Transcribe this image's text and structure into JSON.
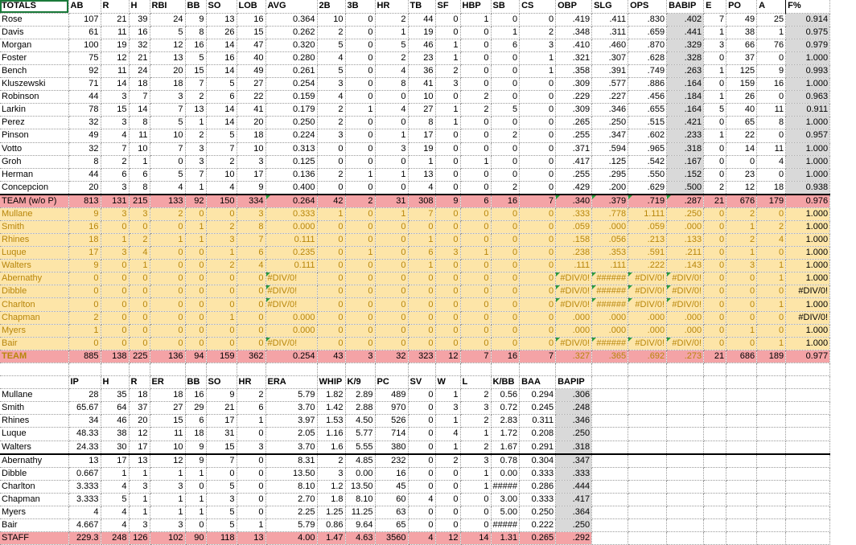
{
  "batting_header": [
    "TOTALS",
    "AB",
    "R",
    "H",
    "RBI",
    "BB",
    "SO",
    "LOB",
    "AVG",
    "2B",
    "3B",
    "HR",
    "TB",
    "SF",
    "HBP",
    "SB",
    "CS",
    "OBP",
    "SLG",
    "OPS",
    "BABIP",
    "E",
    "PO",
    "A",
    "F%"
  ],
  "batting_rows": [
    [
      "Rose",
      "107",
      "21",
      "39",
      "24",
      "9",
      "13",
      "16",
      "0.364",
      "10",
      "0",
      "2",
      "44",
      "0",
      "1",
      "0",
      "0",
      ".419",
      ".411",
      ".830",
      ".402",
      "7",
      "49",
      "25",
      "0.914"
    ],
    [
      "Davis",
      "61",
      "11",
      "16",
      "5",
      "8",
      "26",
      "15",
      "0.262",
      "2",
      "0",
      "1",
      "19",
      "0",
      "0",
      "1",
      "2",
      ".348",
      ".311",
      ".659",
      ".441",
      "1",
      "38",
      "1",
      "0.975"
    ],
    [
      "Morgan",
      "100",
      "19",
      "32",
      "12",
      "16",
      "14",
      "47",
      "0.320",
      "5",
      "0",
      "5",
      "46",
      "1",
      "0",
      "6",
      "3",
      ".410",
      ".460",
      ".870",
      ".329",
      "3",
      "66",
      "76",
      "0.979"
    ],
    [
      "Foster",
      "75",
      "12",
      "21",
      "13",
      "5",
      "16",
      "40",
      "0.280",
      "4",
      "0",
      "2",
      "23",
      "1",
      "0",
      "0",
      "1",
      ".321",
      ".307",
      ".628",
      ".328",
      "0",
      "37",
      "0",
      "1.000"
    ],
    [
      "Bench",
      "92",
      "11",
      "24",
      "20",
      "15",
      "14",
      "49",
      "0.261",
      "5",
      "0",
      "4",
      "36",
      "2",
      "0",
      "0",
      "1",
      ".358",
      ".391",
      ".749",
      ".263",
      "1",
      "125",
      "9",
      "0.993"
    ],
    [
      "Kluszewski",
      "71",
      "14",
      "18",
      "18",
      "7",
      "5",
      "27",
      "0.254",
      "3",
      "0",
      "8",
      "41",
      "3",
      "0",
      "0",
      "0",
      ".309",
      ".577",
      ".886",
      ".164",
      "0",
      "159",
      "16",
      "1.000"
    ],
    [
      "Robinson",
      "44",
      "3",
      "7",
      "3",
      "2",
      "6",
      "22",
      "0.159",
      "4",
      "0",
      "0",
      "10",
      "0",
      "2",
      "0",
      "0",
      ".229",
      ".227",
      ".456",
      ".184",
      "1",
      "26",
      "0",
      "0.963"
    ],
    [
      "Larkin",
      "78",
      "15",
      "14",
      "7",
      "13",
      "14",
      "41",
      "0.179",
      "2",
      "1",
      "4",
      "27",
      "1",
      "2",
      "5",
      "0",
      ".309",
      ".346",
      ".655",
      ".164",
      "5",
      "40",
      "11",
      "0.911"
    ],
    [
      "Perez",
      "32",
      "3",
      "8",
      "5",
      "1",
      "14",
      "20",
      "0.250",
      "2",
      "0",
      "0",
      "8",
      "1",
      "0",
      "0",
      "0",
      ".265",
      ".250",
      ".515",
      ".421",
      "0",
      "65",
      "8",
      "1.000"
    ],
    [
      "Pinson",
      "49",
      "4",
      "11",
      "10",
      "2",
      "5",
      "18",
      "0.224",
      "3",
      "0",
      "1",
      "17",
      "0",
      "0",
      "2",
      "0",
      ".255",
      ".347",
      ".602",
      ".233",
      "1",
      "22",
      "0",
      "0.957"
    ],
    [
      "Votto",
      "32",
      "7",
      "10",
      "7",
      "3",
      "7",
      "10",
      "0.313",
      "0",
      "0",
      "3",
      "19",
      "0",
      "0",
      "0",
      "0",
      ".371",
      ".594",
      ".965",
      ".318",
      "0",
      "14",
      "11",
      "1.000"
    ],
    [
      "Groh",
      "8",
      "2",
      "1",
      "0",
      "3",
      "2",
      "3",
      "0.125",
      "0",
      "0",
      "0",
      "1",
      "0",
      "1",
      "0",
      "0",
      ".417",
      ".125",
      ".542",
      ".167",
      "0",
      "0",
      "4",
      "1.000"
    ],
    [
      "Herman",
      "44",
      "6",
      "6",
      "5",
      "7",
      "10",
      "17",
      "0.136",
      "2",
      "1",
      "1",
      "13",
      "0",
      "0",
      "0",
      "0",
      ".255",
      ".295",
      ".550",
      ".152",
      "0",
      "23",
      "0",
      "1.000"
    ],
    [
      "Concepcion",
      "20",
      "3",
      "8",
      "4",
      "1",
      "4",
      "9",
      "0.400",
      "0",
      "0",
      "0",
      "4",
      "0",
      "0",
      "2",
      "0",
      ".429",
      ".200",
      ".629",
      ".500",
      "2",
      "12",
      "18",
      "0.938"
    ]
  ],
  "team_wo_p": [
    "TEAM (w/o P)",
    "813",
    "131",
    "215",
    "133",
    "92",
    "150",
    "334",
    "0.264",
    "42",
    "2",
    "31",
    "308",
    "9",
    "6",
    "16",
    "7",
    ".340",
    ".379",
    ".719",
    ".287",
    "21",
    "676",
    "179",
    "0.976"
  ],
  "pitcher_bat_rows": [
    [
      "Mullane",
      "9",
      "3",
      "3",
      "2",
      "0",
      "0",
      "3",
      "0.333",
      "1",
      "0",
      "1",
      "7",
      "0",
      "0",
      "0",
      "0",
      ".333",
      ".778",
      "1.111",
      ".250",
      "0",
      "2",
      "0",
      "1.000"
    ],
    [
      "Smith",
      "16",
      "0",
      "0",
      "0",
      "1",
      "2",
      "8",
      "0.000",
      "0",
      "0",
      "0",
      "0",
      "0",
      "0",
      "0",
      "0",
      ".059",
      ".000",
      ".059",
      ".000",
      "0",
      "1",
      "2",
      "1.000"
    ],
    [
      "Rhines",
      "18",
      "1",
      "2",
      "1",
      "1",
      "3",
      "7",
      "0.111",
      "0",
      "0",
      "0",
      "1",
      "0",
      "0",
      "0",
      "0",
      ".158",
      ".056",
      ".213",
      ".133",
      "0",
      "2",
      "4",
      "1.000"
    ],
    [
      "Luque",
      "17",
      "3",
      "4",
      "0",
      "0",
      "1",
      "6",
      "0.235",
      "0",
      "1",
      "0",
      "6",
      "3",
      "1",
      "0",
      "0",
      ".238",
      ".353",
      ".591",
      ".211",
      "0",
      "1",
      "0",
      "1.000"
    ],
    [
      "Walters",
      "9",
      "0",
      "1",
      "0",
      "0",
      "2",
      "4",
      "0.111",
      "0",
      "0",
      "0",
      "1",
      "0",
      "0",
      "0",
      "0",
      ".111",
      ".111",
      ".222",
      ".143",
      "0",
      "3",
      "1",
      "1.000"
    ],
    [
      "Abernathy",
      "0",
      "0",
      "0",
      "0",
      "0",
      "0",
      "0",
      "#DIV/0!",
      "0",
      "0",
      "0",
      "0",
      "0",
      "0",
      "0",
      "0",
      "#DIV/0!",
      "######",
      "#DIV/0!",
      "#DIV/0!",
      "0",
      "0",
      "1",
      "1.000"
    ],
    [
      "Dibble",
      "0",
      "0",
      "0",
      "0",
      "0",
      "0",
      "0",
      "#DIV/0!",
      "0",
      "0",
      "0",
      "0",
      "0",
      "0",
      "0",
      "0",
      "#DIV/0!",
      "######",
      "#DIV/0!",
      "#DIV/0!",
      "0",
      "0",
      "0",
      "#DIV/0!"
    ],
    [
      "Charlton",
      "0",
      "0",
      "0",
      "0",
      "0",
      "0",
      "0",
      "#DIV/0!",
      "0",
      "0",
      "0",
      "0",
      "0",
      "0",
      "0",
      "0",
      "#DIV/0!",
      "######",
      "#DIV/0!",
      "#DIV/0!",
      "0",
      "0",
      "1",
      "1.000"
    ],
    [
      "Chapman",
      "2",
      "0",
      "0",
      "0",
      "0",
      "1",
      "0",
      "0.000",
      "0",
      "0",
      "0",
      "0",
      "0",
      "0",
      "0",
      "0",
      ".000",
      ".000",
      ".000",
      ".000",
      "0",
      "0",
      "0",
      "#DIV/0!"
    ],
    [
      "Myers",
      "1",
      "0",
      "0",
      "0",
      "0",
      "0",
      "0",
      "0.000",
      "0",
      "0",
      "0",
      "0",
      "0",
      "0",
      "0",
      "0",
      ".000",
      ".000",
      ".000",
      ".000",
      "0",
      "1",
      "0",
      "1.000"
    ],
    [
      "Bair",
      "0",
      "0",
      "0",
      "0",
      "0",
      "0",
      "0",
      "#DIV/0!",
      "0",
      "0",
      "0",
      "0",
      "0",
      "0",
      "0",
      "0",
      "#DIV/0!",
      "######",
      "#DIV/0!",
      "#DIV/0!",
      "0",
      "0",
      "1",
      "1.000"
    ]
  ],
  "team_all": [
    "TEAM",
    "885",
    "138",
    "225",
    "136",
    "94",
    "159",
    "362",
    "0.254",
    "43",
    "3",
    "32",
    "323",
    "12",
    "7",
    "16",
    "7",
    ".327",
    ".365",
    ".692",
    ".273",
    "21",
    "686",
    "189",
    "0.977"
  ],
  "pitching_header": [
    "",
    "IP",
    "H",
    "R",
    "ER",
    "BB",
    "SO",
    "HR",
    "ERA",
    "WHIP",
    "K/9",
    "PC",
    "SV",
    "W",
    "L",
    "K/BB",
    "BAA",
    "BAPIP"
  ],
  "pitching_rows": [
    [
      "Mullane",
      "28",
      "35",
      "18",
      "18",
      "16",
      "9",
      "2",
      "5.79",
      "1.82",
      "2.89",
      "489",
      "0",
      "1",
      "2",
      "0.56",
      "0.294",
      ".306"
    ],
    [
      "Smith",
      "65.67",
      "64",
      "37",
      "27",
      "29",
      "21",
      "6",
      "3.70",
      "1.42",
      "2.88",
      "970",
      "0",
      "3",
      "3",
      "0.72",
      "0.245",
      ".248"
    ],
    [
      "Rhines",
      "34",
      "46",
      "20",
      "15",
      "6",
      "17",
      "1",
      "3.97",
      "1.53",
      "4.50",
      "526",
      "0",
      "1",
      "2",
      "2.83",
      "0.311",
      ".346"
    ],
    [
      "Luque",
      "48.33",
      "38",
      "12",
      "11",
      "18",
      "31",
      "0",
      "2.05",
      "1.16",
      "5.77",
      "714",
      "0",
      "4",
      "1",
      "1.72",
      "0.208",
      ".250"
    ],
    [
      "Walters",
      "24.33",
      "30",
      "17",
      "10",
      "9",
      "15",
      "3",
      "3.70",
      "1.6",
      "5.55",
      "380",
      "0",
      "1",
      "2",
      "1.67",
      "0.291",
      ".318"
    ],
    [
      "Abernathy",
      "13",
      "17",
      "13",
      "12",
      "9",
      "7",
      "0",
      "8.31",
      "2",
      "4.85",
      "232",
      "0",
      "2",
      "3",
      "0.78",
      "0.304",
      ".347"
    ],
    [
      "Dibble",
      "0.667",
      "1",
      "1",
      "1",
      "1",
      "0",
      "0",
      "13.50",
      "3",
      "0.00",
      "16",
      "0",
      "0",
      "1",
      "0.00",
      "0.333",
      ".333"
    ],
    [
      "Charlton",
      "3.333",
      "4",
      "3",
      "3",
      "0",
      "5",
      "0",
      "8.10",
      "1.2",
      "13.50",
      "45",
      "0",
      "0",
      "1",
      "#####",
      "0.286",
      ".444"
    ],
    [
      "Chapman",
      "3.333",
      "5",
      "1",
      "1",
      "1",
      "3",
      "0",
      "2.70",
      "1.8",
      "8.10",
      "60",
      "4",
      "0",
      "0",
      "3.00",
      "0.333",
      ".417"
    ],
    [
      "Myers",
      "4",
      "4",
      "1",
      "1",
      "1",
      "5",
      "0",
      "2.25",
      "1.25",
      "11.25",
      "63",
      "0",
      "0",
      "0",
      "5.00",
      "0.250",
      ".364"
    ],
    [
      "Bair",
      "4.667",
      "4",
      "3",
      "3",
      "0",
      "5",
      "1",
      "5.79",
      "0.86",
      "9.64",
      "65",
      "0",
      "0",
      "0",
      "#####",
      "0.222",
      ".250"
    ]
  ],
  "staff": [
    "STAFF",
    "229.3",
    "248",
    "126",
    "102",
    "90",
    "118",
    "13",
    "4.00",
    "1.47",
    "4.63",
    "3560",
    "4",
    "12",
    "14",
    "1.31",
    "0.265",
    ".292"
  ],
  "colors": {
    "team": "#f4a3a6",
    "pitcher_rows": "#fde5a8",
    "highlight": "#2eb0f0",
    "selected": "#1a7a3a",
    "shaded": "#d9d9d9"
  }
}
